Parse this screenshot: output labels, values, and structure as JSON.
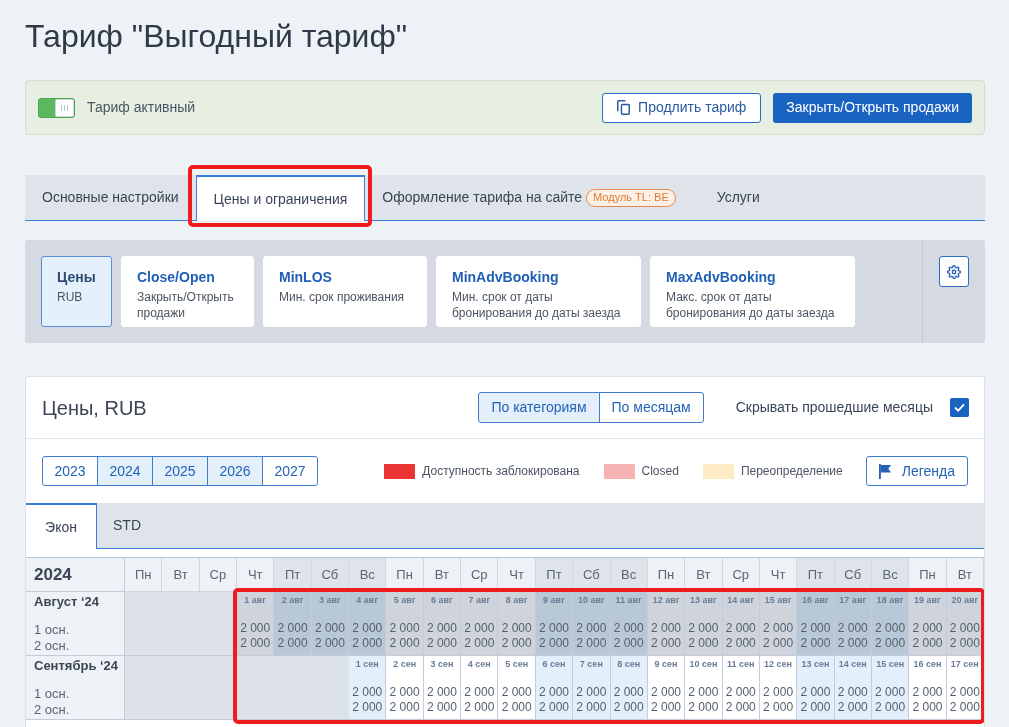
{
  "page": {
    "title": "Тариф \"Выгодный тариф\""
  },
  "status_panel": {
    "toggle": {
      "label": "Тариф активный",
      "on": true
    },
    "buttons": [
      {
        "label": "Продлить тариф",
        "kind": "outline"
      },
      {
        "label": "Закрыть/Открыть продажи",
        "kind": "primary"
      }
    ]
  },
  "tabs": [
    {
      "label": "Основные настройки",
      "selected": false,
      "highlighted": false
    },
    {
      "label": "Цены и ограничения",
      "selected": true,
      "highlighted": true
    },
    {
      "label": "Оформление тарифа на сайте",
      "selected": false,
      "highlighted": false,
      "badge": "Модуль TL: BE"
    },
    {
      "label": "Услуги",
      "selected": false,
      "highlighted": false
    }
  ],
  "modes": [
    {
      "title": "Цены",
      "subtitle": "RUB",
      "selected": true
    },
    {
      "title": "Close/Open",
      "subtitle": "Закрыть/Открыть продажи",
      "selected": false
    },
    {
      "title": "MinLOS",
      "subtitle": "Мин. срок проживания",
      "selected": false
    },
    {
      "title": "MinAdvBooking",
      "subtitle": "Мин. срок от даты бронирования до даты заезда",
      "selected": false
    },
    {
      "title": "MaxAdvBooking",
      "subtitle": "Макс. срок от даты бронирования до даты заезда",
      "selected": false
    }
  ],
  "prices": {
    "title": "Цены, RUB",
    "view_switch": [
      {
        "label": "По категориям",
        "selected": true
      },
      {
        "label": "По месяцам",
        "selected": false
      }
    ],
    "hide_past": {
      "label": "Скрывать прошедшие месяцы",
      "checked": true
    },
    "years": [
      {
        "label": "2023",
        "selected": false
      },
      {
        "label": "2024",
        "selected": true
      },
      {
        "label": "2025",
        "selected": true
      },
      {
        "label": "2026",
        "selected": true
      },
      {
        "label": "2027",
        "selected": false
      }
    ],
    "legend": [
      {
        "label": "Доступность заблокирована",
        "color": "#ea3434"
      },
      {
        "label": "Closed",
        "color": "#f6b3b3"
      },
      {
        "label": "Переопределение",
        "color": "#fcebc4"
      }
    ],
    "legend_button": "Легенда",
    "categories": [
      {
        "label": "Экон",
        "selected": true
      },
      {
        "label": "STD",
        "selected": false
      }
    ],
    "calendar": {
      "year": "2024",
      "highlighted": true,
      "weekdays": [
        {
          "label": "Пн",
          "weekend": false
        },
        {
          "label": "Вт",
          "weekend": false
        },
        {
          "label": "Ср",
          "weekend": false
        },
        {
          "label": "Чт",
          "weekend": false
        },
        {
          "label": "Пт",
          "weekend": true
        },
        {
          "label": "Сб",
          "weekend": true
        },
        {
          "label": "Вс",
          "weekend": true
        },
        {
          "label": "Пн",
          "weekend": false
        },
        {
          "label": "Вт",
          "weekend": false
        },
        {
          "label": "Ср",
          "weekend": false
        },
        {
          "label": "Чт",
          "weekend": false
        },
        {
          "label": "Пт",
          "weekend": true
        },
        {
          "label": "Сб",
          "weekend": true
        },
        {
          "label": "Вс",
          "weekend": true
        },
        {
          "label": "Пн",
          "weekend": false
        },
        {
          "label": "Вт",
          "weekend": false
        },
        {
          "label": "Ср",
          "weekend": false
        },
        {
          "label": "Чт",
          "weekend": false
        },
        {
          "label": "Пт",
          "weekend": true
        },
        {
          "label": "Сб",
          "weekend": true
        },
        {
          "label": "Вс",
          "weekend": true
        },
        {
          "label": "Пн",
          "weekend": false
        },
        {
          "label": "Вт",
          "weekend": false
        }
      ],
      "months": [
        {
          "label": "Август ‘24",
          "rate_rows": [
            "1 осн.",
            "2 осн."
          ],
          "days": [
            {
              "kind": "blank"
            },
            {
              "kind": "blank"
            },
            {
              "kind": "blank"
            },
            {
              "kind": "day",
              "date": "1 авг",
              "past": true,
              "prices": [
                "2 000",
                "2 000"
              ]
            },
            {
              "kind": "day",
              "date": "2 авг",
              "past": true,
              "prices": [
                "2 000",
                "2 000"
              ]
            },
            {
              "kind": "day",
              "date": "3 авг",
              "past": true,
              "prices": [
                "2 000",
                "2 000"
              ]
            },
            {
              "kind": "day",
              "date": "4 авг",
              "past": true,
              "prices": [
                "2 000",
                "2 000"
              ]
            },
            {
              "kind": "day",
              "date": "5 авг",
              "past": true,
              "prices": [
                "2 000",
                "2 000"
              ]
            },
            {
              "kind": "day",
              "date": "6 авг",
              "past": true,
              "prices": [
                "2 000",
                "2 000"
              ]
            },
            {
              "kind": "day",
              "date": "7 авг",
              "past": true,
              "prices": [
                "2 000",
                "2 000"
              ]
            },
            {
              "kind": "day",
              "date": "8 авг",
              "past": true,
              "prices": [
                "2 000",
                "2 000"
              ]
            },
            {
              "kind": "day",
              "date": "9 авг",
              "past": true,
              "prices": [
                "2 000",
                "2 000"
              ]
            },
            {
              "kind": "day",
              "date": "10 авг",
              "past": true,
              "prices": [
                "2 000",
                "2 000"
              ]
            },
            {
              "kind": "day",
              "date": "11 авг",
              "past": true,
              "prices": [
                "2 000",
                "2 000"
              ]
            },
            {
              "kind": "day",
              "date": "12 авг",
              "past": true,
              "prices": [
                "2 000",
                "2 000"
              ]
            },
            {
              "kind": "day",
              "date": "13 авг",
              "past": true,
              "prices": [
                "2 000",
                "2 000"
              ]
            },
            {
              "kind": "day",
              "date": "14 авг",
              "past": true,
              "prices": [
                "2 000",
                "2 000"
              ]
            },
            {
              "kind": "day",
              "date": "15 авг",
              "past": true,
              "prices": [
                "2 000",
                "2 000"
              ]
            },
            {
              "kind": "day",
              "date": "16 авг",
              "past": true,
              "prices": [
                "2 000",
                "2 000"
              ]
            },
            {
              "kind": "day",
              "date": "17 авг",
              "past": true,
              "prices": [
                "2 000",
                "2 000"
              ]
            },
            {
              "kind": "day",
              "date": "18 авг",
              "past": true,
              "prices": [
                "2 000",
                "2 000"
              ]
            },
            {
              "kind": "day",
              "date": "19 авг",
              "past": true,
              "prices": [
                "2 000",
                "2 000"
              ]
            },
            {
              "kind": "day",
              "date": "20 авг",
              "past": true,
              "prices": [
                "2 000",
                "2 000"
              ]
            }
          ]
        },
        {
          "label": "Сентябрь ‘24",
          "rate_rows": [
            "1 осн.",
            "2 осн."
          ],
          "days": [
            {
              "kind": "blank"
            },
            {
              "kind": "blank"
            },
            {
              "kind": "blank"
            },
            {
              "kind": "blank"
            },
            {
              "kind": "blank"
            },
            {
              "kind": "blank"
            },
            {
              "kind": "day",
              "date": "1 сен",
              "past": false,
              "prices": [
                "2 000",
                "2 000"
              ]
            },
            {
              "kind": "day",
              "date": "2 сен",
              "past": false,
              "prices": [
                "2 000",
                "2 000"
              ]
            },
            {
              "kind": "day",
              "date": "3 сен",
              "past": false,
              "prices": [
                "2 000",
                "2 000"
              ]
            },
            {
              "kind": "day",
              "date": "4 сен",
              "past": false,
              "prices": [
                "2 000",
                "2 000"
              ]
            },
            {
              "kind": "day",
              "date": "5 сен",
              "past": false,
              "prices": [
                "2 000",
                "2 000"
              ]
            },
            {
              "kind": "day",
              "date": "6 сен",
              "past": false,
              "prices": [
                "2 000",
                "2 000"
              ]
            },
            {
              "kind": "day",
              "date": "7 сен",
              "past": false,
              "prices": [
                "2 000",
                "2 000"
              ]
            },
            {
              "kind": "day",
              "date": "8 сен",
              "past": false,
              "prices": [
                "2 000",
                "2 000"
              ]
            },
            {
              "kind": "day",
              "date": "9 сен",
              "past": false,
              "prices": [
                "2 000",
                "2 000"
              ]
            },
            {
              "kind": "day",
              "date": "10 сен",
              "past": false,
              "prices": [
                "2 000",
                "2 000"
              ]
            },
            {
              "kind": "day",
              "date": "11 сен",
              "past": false,
              "prices": [
                "2 000",
                "2 000"
              ]
            },
            {
              "kind": "day",
              "date": "12 сен",
              "past": false,
              "prices": [
                "2 000",
                "2 000"
              ]
            },
            {
              "kind": "day",
              "date": "13 сен",
              "past": false,
              "prices": [
                "2 000",
                "2 000"
              ]
            },
            {
              "kind": "day",
              "date": "14 сен",
              "past": false,
              "prices": [
                "2 000",
                "2 000"
              ]
            },
            {
              "kind": "day",
              "date": "15 сен",
              "past": false,
              "prices": [
                "2 000",
                "2 000"
              ]
            },
            {
              "kind": "day",
              "date": "16 сен",
              "past": false,
              "prices": [
                "2 000",
                "2 000"
              ]
            },
            {
              "kind": "day",
              "date": "17 сен",
              "past": false,
              "prices": [
                "2 000",
                "2 000"
              ]
            }
          ]
        }
      ]
    }
  }
}
